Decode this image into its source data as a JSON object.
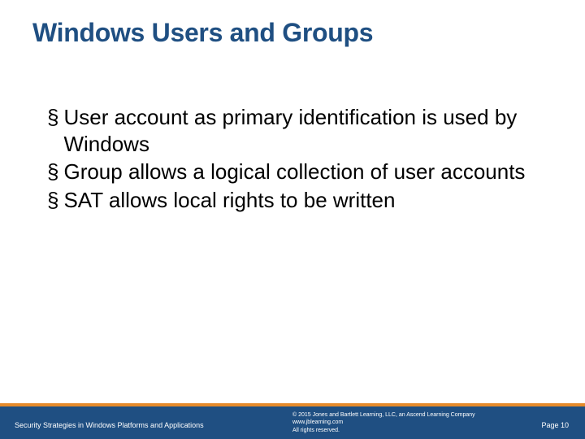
{
  "title": "Windows Users and Groups",
  "bullets": [
    "User account as primary identification is used by Windows",
    "Group allows a logical collection of user accounts",
    "SAT allows local rights to be written"
  ],
  "footer": {
    "left": "Security Strategies in Windows Platforms and Applications",
    "copyright_line1": "© 2015 Jones and Bartlett Learning, LLC, an Ascend Learning Company",
    "copyright_line2": "www.jblearning.com",
    "copyright_line3": "All rights reserved.",
    "page_label": "Page 10"
  }
}
